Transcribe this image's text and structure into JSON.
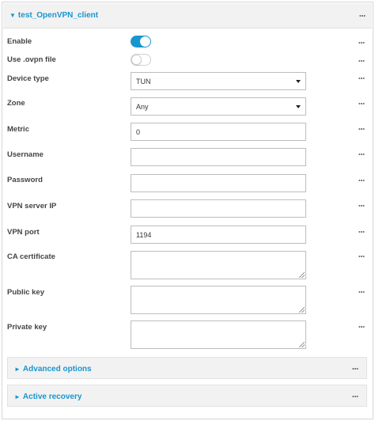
{
  "section": {
    "caret": "▼",
    "title": "test_OpenVPN_client"
  },
  "fields": {
    "enable": {
      "label": "Enable",
      "state": "on"
    },
    "use_ovpn": {
      "label": "Use .ovpn file",
      "state": "off"
    },
    "device_type": {
      "label": "Device type",
      "value": "TUN"
    },
    "zone": {
      "label": "Zone",
      "value": "Any"
    },
    "metric": {
      "label": "Metric",
      "value": "0"
    },
    "username": {
      "label": "Username",
      "value": ""
    },
    "password": {
      "label": "Password",
      "value": ""
    },
    "server_ip": {
      "label": "VPN server IP",
      "value": ""
    },
    "port": {
      "label": "VPN port",
      "value": "1194"
    },
    "ca_cert": {
      "label": "CA certificate",
      "value": ""
    },
    "public_key": {
      "label": "Public key",
      "value": ""
    },
    "private_key": {
      "label": "Private key",
      "value": ""
    }
  },
  "subsections": {
    "advanced": {
      "caret": "►",
      "title": "Advanced options"
    },
    "recovery": {
      "caret": "►",
      "title": "Active recovery"
    }
  },
  "colors": {
    "accent": "#1996ce",
    "header_bg": "#f2f2f2"
  },
  "icons": {
    "menu": "more-dots-icon",
    "dropdown": "caret-down-icon"
  }
}
